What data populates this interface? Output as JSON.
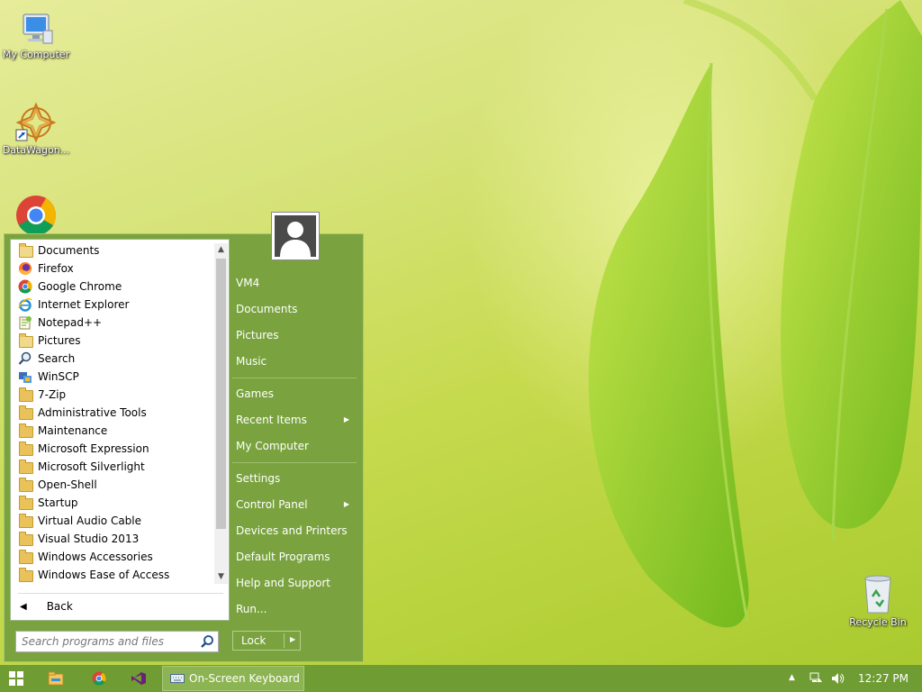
{
  "desktop": {
    "icons": [
      {
        "label": "My Computer",
        "icon": "computer-icon"
      },
      {
        "label": "DataWagon...",
        "icon": "datawagon-icon"
      },
      {
        "label": "",
        "icon": "chrome-icon"
      },
      {
        "label": "Recycle Bin",
        "icon": "recycle-bin-icon"
      }
    ]
  },
  "start_menu": {
    "programs": [
      {
        "label": "Documents",
        "icon": "documents-icon"
      },
      {
        "label": "Firefox",
        "icon": "firefox-icon"
      },
      {
        "label": "Google Chrome",
        "icon": "chrome-icon"
      },
      {
        "label": "Internet Explorer",
        "icon": "internet-explorer-icon"
      },
      {
        "label": "Notepad++",
        "icon": "notepad-plus-plus-icon"
      },
      {
        "label": "Pictures",
        "icon": "pictures-icon"
      },
      {
        "label": "Search",
        "icon": "search-icon"
      },
      {
        "label": "WinSCP",
        "icon": "winscp-icon"
      },
      {
        "label": "7-Zip",
        "icon": "folder-icon"
      },
      {
        "label": "Administrative Tools",
        "icon": "folder-icon"
      },
      {
        "label": "Maintenance",
        "icon": "folder-icon"
      },
      {
        "label": "Microsoft Expression",
        "icon": "folder-icon"
      },
      {
        "label": "Microsoft Silverlight",
        "icon": "folder-icon"
      },
      {
        "label": "Open-Shell",
        "icon": "folder-icon"
      },
      {
        "label": "Startup",
        "icon": "folder-icon"
      },
      {
        "label": "Virtual Audio Cable",
        "icon": "folder-icon"
      },
      {
        "label": "Visual Studio 2013",
        "icon": "folder-icon"
      },
      {
        "label": "Windows Accessories",
        "icon": "folder-icon"
      },
      {
        "label": "Windows Ease of Access",
        "icon": "folder-icon"
      }
    ],
    "back_label": "Back",
    "search_placeholder": "Search programs and files",
    "right_items": [
      {
        "label": "VM4",
        "submenu": false
      },
      {
        "label": "Documents",
        "submenu": false
      },
      {
        "label": "Pictures",
        "submenu": false
      },
      {
        "label": "Music",
        "submenu": false
      },
      {
        "label": "Games",
        "submenu": false
      },
      {
        "label": "Recent Items",
        "submenu": true
      },
      {
        "label": "My Computer",
        "submenu": false
      },
      {
        "label": "Settings",
        "submenu": false
      },
      {
        "label": "Control Panel",
        "submenu": true
      },
      {
        "label": "Devices and Printers",
        "submenu": false
      },
      {
        "label": "Default Programs",
        "submenu": false
      },
      {
        "label": "Help and Support",
        "submenu": false
      },
      {
        "label": "Run...",
        "submenu": false
      }
    ],
    "lock_label": "Lock"
  },
  "taskbar": {
    "pinned": [
      "windows-start-icon",
      "file-explorer-icon",
      "chrome-icon",
      "visual-studio-icon"
    ],
    "active_task": "On-Screen Keyboard",
    "clock": "12:27 PM"
  },
  "colors": {
    "menu_green": "#7aa33f",
    "taskbar_green": "#6f9c33"
  }
}
